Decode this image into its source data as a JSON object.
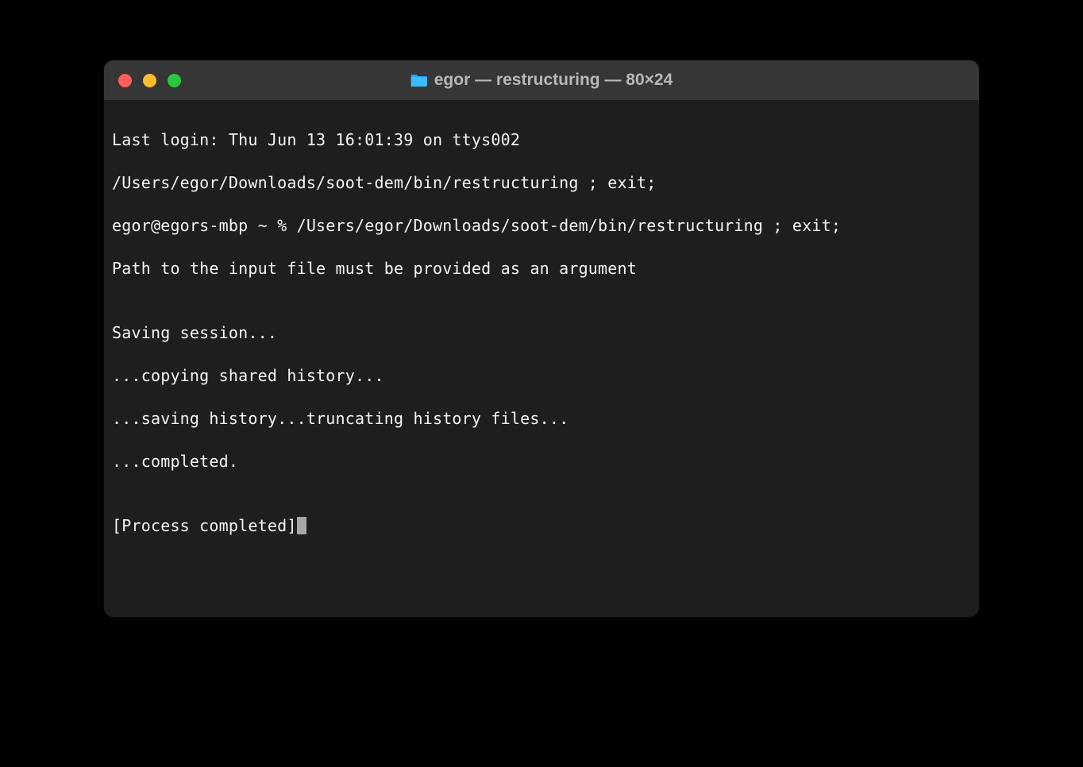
{
  "window": {
    "title": "egor — restructuring — 80×24"
  },
  "terminal": {
    "lines": [
      "Last login: Thu Jun 13 16:01:39 on ttys002",
      "/Users/egor/Downloads/soot-dem/bin/restructuring ; exit;",
      "egor@egors-mbp ~ % /Users/egor/Downloads/soot-dem/bin/restructuring ; exit;",
      "Path to the input file must be provided as an argument",
      "",
      "Saving session...",
      "...copying shared history...",
      "...saving history...truncating history files...",
      "...completed.",
      "",
      "[Process completed]"
    ]
  }
}
